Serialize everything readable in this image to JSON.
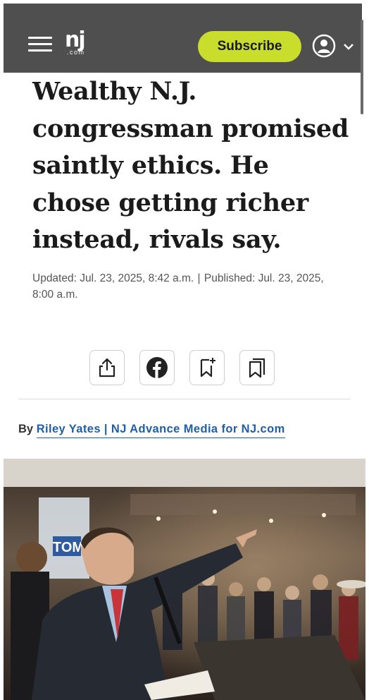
{
  "header": {
    "logo_main": "nj",
    "logo_sub": ".com",
    "subscribe_label": "Subscribe"
  },
  "article": {
    "headline": "Wealthy N.J. congressman promised saintly ethics. He chose getting richer instead, rivals say.",
    "updated": "Updated: Jul. 23, 2025, 8:42 a.m.",
    "separator": "|",
    "published": "Published: Jul. 23, 2025, 8:00 a.m.",
    "byline_prefix": "By",
    "author": "Riley Yates | NJ Advance Media for NJ.com"
  },
  "share_buttons": [
    "share-icon",
    "facebook-icon",
    "bookmark-add-icon",
    "saved-bookmarks-icon"
  ],
  "photo": {
    "sign_text": "TOM"
  },
  "colors": {
    "header_bg": "#4f4f4f",
    "accent": "#c8dd2c",
    "link": "#1f5fa8"
  }
}
